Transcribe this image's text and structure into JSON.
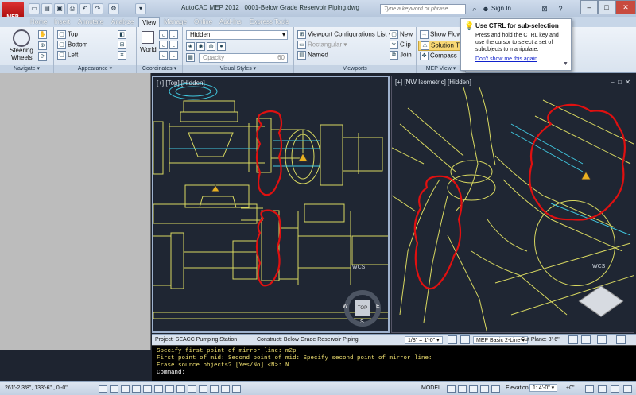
{
  "title_bar": {
    "app_title": "AutoCAD MEP 2012",
    "document": "0001-Below Grade Reservoir Piping.dwg",
    "search_placeholder": "Type a keyword or phrase",
    "sign_in": "Sign In",
    "app_label": "MEP"
  },
  "tabs": [
    "Home",
    "Insert",
    "Annotate",
    "Analyze",
    "View",
    "Manage",
    "Online",
    "Add-Ins",
    "Express Tools"
  ],
  "active_tab": "View",
  "ribbon": {
    "navigate": {
      "title": "Navigate",
      "steering": "Steering",
      "wheels": "Wheels"
    },
    "appearance": {
      "title": "Appearance",
      "top": "Top",
      "bottom": "Bottom",
      "left": "Left"
    },
    "coordinates": {
      "title": "Coordinates",
      "world": "World"
    },
    "visual_styles": {
      "title": "Visual Styles",
      "style": "Hidden",
      "opacity": "Opacity",
      "opacity_value": "60"
    },
    "viewports": {
      "title": "Viewports",
      "config": "Viewport Configurations List",
      "rectangular": "Rectangular",
      "named": "Named",
      "new": "New",
      "clip": "Clip",
      "join": "Join"
    },
    "mep_view": {
      "title": "MEP View",
      "show_flow": "Show Flow",
      "solution_tips": "Solution Tips",
      "compass": "Compass"
    }
  },
  "tooltip": {
    "title": "Use CTRL for sub-selection",
    "body": "Press and hold the CTRL key and use the cursor to select a set of subobjects to manipulate.",
    "link": "Don't show me this again"
  },
  "viewports": {
    "top_label": "[+] [Top] [Hidden]",
    "iso_label": "[+] [NW Isometric] [Hidden]",
    "wcs": "WCS",
    "compass_top": "TOP",
    "compass_w": "W",
    "compass_e": "E",
    "compass_s": "S"
  },
  "drawing_status": {
    "project": "Project: SEACC Pumping Station",
    "construct": "Construct: Below Grade Reservoir Piping",
    "scale": "1/8\" = 1'-0\"",
    "display": "MEP Basic 2-Line",
    "cut_plane": "Cut Plane: 3'-6\""
  },
  "command_history": [
    "Specify first point of mirror line: m2p",
    "First point of mid: Second point of mid: Specify second point of mirror line:",
    "Erase source objects? [Yes/No] <N>: N"
  ],
  "command_prompt": "Command:",
  "status_bar": {
    "coords": "261'-2 3/8\",  133'-6\" ,  0'-0\"",
    "model": "MODEL",
    "elevation": "Elevation:",
    "elevation_value": "1: 4'-0\"",
    "plus": "+0\""
  },
  "colors": {
    "drawing_bg": "#1f2633",
    "linework": "#d8d860",
    "highlight": "#e01010",
    "cyan": "#40c8e0"
  }
}
